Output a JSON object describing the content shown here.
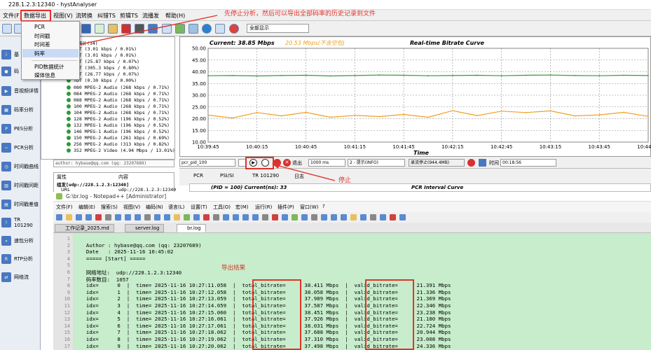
{
  "window": {
    "title": "228.1.2.3:12340 - hystAnalyser"
  },
  "menu": {
    "items": [
      "文件(F)",
      "数据导出",
      "视图(V)",
      "流转换",
      "纠错TS",
      "剪辑TS",
      "流播发",
      "帮助(H)"
    ]
  },
  "dropdown": {
    "items": [
      "PCR",
      "时间戳",
      "时间差",
      "码率",
      "PID数据统计",
      "媒体信息"
    ]
  },
  "toolbar": {
    "select_value": "全部显示"
  },
  "sidebar": {
    "items": [
      "基",
      "码",
      "音视频详情",
      "码率分析",
      "PES分析",
      "PCR分析",
      "时间戳曲线",
      "时间戳间距",
      "时间戳差值",
      "TR 101290",
      "速包分析",
      "RTP分析",
      "网络流"
    ]
  },
  "tree": {
    "header": "统计(34)",
    "rows": [
      "CAT (3.01 kbps / 0.01%)",
      "CAT (3.01 kbps / 0.01%)",
      "NIT (25.87 kbps / 0.07%)",
      "SDT (305.3 kbps / 0.80%)",
      "EIT (26.77 kbps / 0.07%)",
      "TDT (0.30 kbps / 0.00%)",
      "080 MPEG-2 Audio (268 kbps / 0.71%)",
      "084 MPEG-2 Audio (268 kbps / 0.71%)",
      "088 MPEG-2 Audio (268 kbps / 0.71%)",
      "100 MPEG-2 Audio (268 kbps / 0.71%)",
      "104 MPEG-2 Audio (268 kbps / 0.71%)",
      "128 MPEG-2 Audio (196 kbps / 0.52%)",
      "132 MPEG-1 Audio (196 kbps / 0.52%)",
      "146 MPEG-1 Audio (196 kbps / 0.52%)",
      "150 MPEG-2 Audio (261 kbps / 0.69%)",
      "256 MPEG-2 Audio (313 kbps / 0.82%)",
      "352 MPEG-2 Video (4.94 Mbps / 13.01%)"
    ],
    "author_line": "author: hybase@qq.com (qq: 23207689)"
  },
  "props": {
    "col1": "属性",
    "col2": "内容",
    "row1_label": "组发[udp://228.1.2.3:12340]",
    "row2_a": "URL",
    "row2_b": "udp://228.1.2.3:12340"
  },
  "chart": {
    "current_label": "Current: 38.85 Mbps",
    "valid_label": "20.53 Mbps(不含空包)",
    "title": "Real-time Bitrate Curve",
    "xlabel": "Time"
  },
  "chart_data": {
    "type": "line",
    "title": "Real-time Bitrate Curve",
    "xlabel": "Time",
    "ylabel": "",
    "ylim": [
      10,
      50
    ],
    "yticks": [
      "50.00",
      "45.00",
      "40.00",
      "35.00",
      "30.00",
      "25.00",
      "20.00",
      "15.00",
      "10.00"
    ],
    "x": [
      "10:39:45",
      "10:40:00",
      "10:40:15",
      "10:40:30",
      "10:40:45",
      "10:41:00",
      "10:41:15",
      "10:41:30",
      "10:41:45",
      "10:42:00",
      "10:42:15",
      "10:42:30",
      "10:42:45",
      "10:43:00",
      "10:43:15",
      "10:43:30",
      "10:43:45",
      "10:44:00",
      "10:44:15"
    ],
    "xtick_labels": [
      "10:39:45",
      "10:40:15",
      "10:40:45",
      "10:41:15",
      "10:41:45",
      "10:42:15",
      "10:42:45",
      "10:43:15",
      "10:43:45",
      "10:44:15"
    ],
    "series": [
      {
        "name": "Current",
        "color": "#2e9a3a",
        "values": [
          38.3,
          38.4,
          38.2,
          38.4,
          38.5,
          38.2,
          38.4,
          38.6,
          38.5,
          38.3,
          38.4,
          38.5,
          38.3,
          38.5,
          38.6,
          38.4,
          38.3,
          38.5,
          38.4
        ]
      },
      {
        "name": "Valid",
        "color": "#f0a020",
        "values": [
          21.5,
          20.3,
          22.6,
          21.2,
          22.7,
          20.6,
          21.4,
          20.9,
          21.8,
          20.6,
          23.4,
          21.3,
          23.2,
          22.6,
          23.3,
          21.2,
          21.6,
          22.7,
          21.0
        ]
      }
    ]
  },
  "controls": {
    "pid_select": "pcr_pid_100",
    "exit_label": "退出",
    "buffer_value": "1000 ms",
    "level_value": "2 - 提示(INFO)",
    "status_text": "录流停止(944.4MB)",
    "time_label": "时间",
    "time_value": "00:18:56"
  },
  "lower_tabs": {
    "items": [
      "PCR",
      "PSI/SI",
      "TR 101290",
      "日志"
    ],
    "pid_line": "(PID = 100)  Current(ns): 33",
    "interval_title": "PCR Interval Curve"
  },
  "notepad": {
    "title": "G:\\br.log - Notepad++ [Administrator]",
    "menu": [
      "文件(F)",
      "编辑(E)",
      "搜索(S)",
      "视图(V)",
      "编码(N)",
      "语言(L)",
      "设置(T)",
      "工具(O)",
      "宏(M)",
      "运行(R)",
      "插件(P)",
      "窗口(W)",
      "?"
    ],
    "tabs": [
      "工作记录_2025.md",
      "server.log",
      "br.log"
    ],
    "lines": [
      "",
      "  Author : hybase@qq.com (qq: 23207689)",
      "  Date   : 2025-11-16 10:45:02",
      "  ===== [Start] =====",
      "",
      "  网络地址:  udp://228.1.2.3:12340",
      "  码率数目:  1057",
      "  idx=      0  |  time= 2025-11-16 10:27:11.058  |  total_bitrate=      38.411 Mbps  |  valid_bitrate=      21.391 Mbps",
      "  idx=      1  |  time= 2025-11-16 10:27:12.058  |  total_bitrate=      38.058 Mbps  |  valid_bitrate=      21.336 Mbps",
      "  idx=      2  |  time= 2025-11-16 10:27:13.059  |  total_bitrate=      37.989 Mbps  |  valid_bitrate=      21.369 Mbps",
      "  idx=      3  |  time= 2025-11-16 10:27:14.059  |  total_bitrate=      37.587 Mbps  |  valid_bitrate=      22.346 Mbps",
      "  idx=      4  |  time= 2025-11-16 10:27:15.060  |  total_bitrate=      38.451 Mbps  |  valid_bitrate=      23.238 Mbps",
      "  idx=      5  |  time= 2025-11-16 10:27:16.061  |  total_bitrate=      37.926 Mbps  |  valid_bitrate=      21.180 Mbps",
      "  idx=      6  |  time= 2025-11-16 10:27:17.061  |  total_bitrate=      38.031 Mbps  |  valid_bitrate=      22.724 Mbps",
      "  idx=      7  |  time= 2025-11-16 10:27:18.062  |  total_bitrate=      37.688 Mbps  |  valid_bitrate=      20.944 Mbps",
      "  idx=      8  |  time= 2025-11-16 10:27:19.062  |  total_bitrate=      37.310 Mbps  |  valid_bitrate=      23.008 Mbps",
      "  idx=      9  |  time= 2025-11-16 10:27:20.062  |  total_bitrate=      37.498 Mbps  |  valid_bitrate=      24.336 Mbps"
    ],
    "line_numbers": [
      "1",
      "2",
      "3",
      "4",
      "5",
      "6",
      "7",
      "8",
      "9",
      "10",
      "11",
      "12",
      "13",
      "14",
      "15",
      "16",
      "17"
    ]
  },
  "annotations": {
    "top": "先停止分析，然后可以导出全部码率的历史记录到文件",
    "stop": "停止",
    "export_result": "导出结果"
  }
}
